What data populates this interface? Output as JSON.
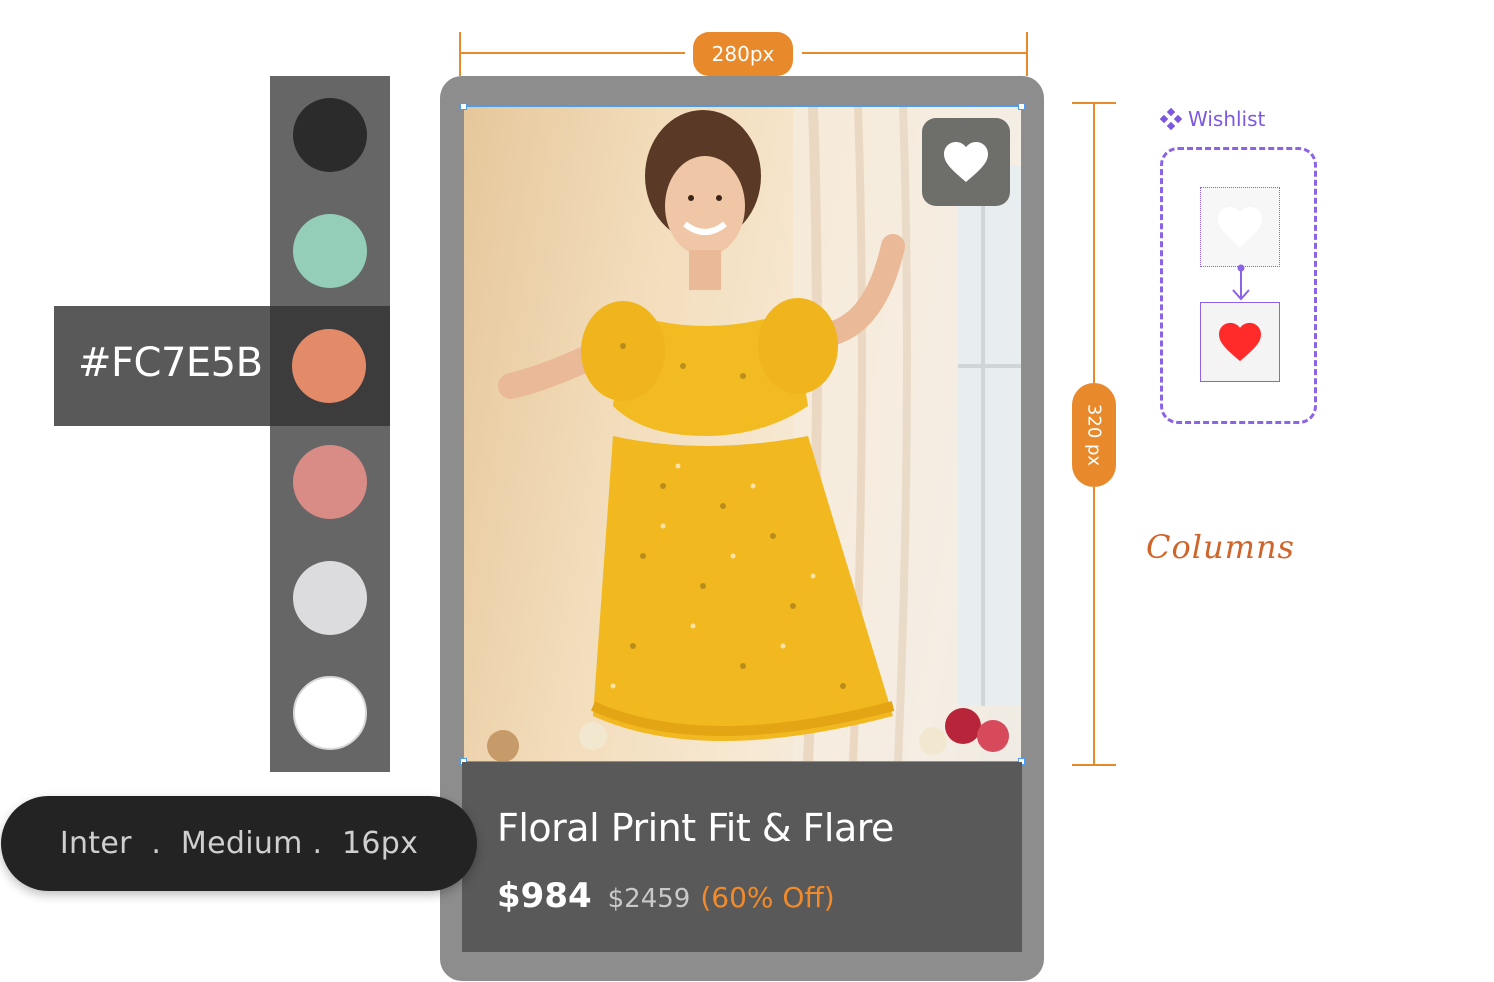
{
  "annotations": {
    "width_label": "280px",
    "height_label": "320 px",
    "accent_color": "#E8892C"
  },
  "product_card": {
    "image_alt": "Woman wearing yellow floral print fit and flare dress",
    "wishlist_icon": "heart-icon",
    "title": "Floral Print Fit & Flare",
    "price_current": "$984",
    "price_original": "$2459",
    "discount": "(60% Off)",
    "discount_color": "#F08A2B"
  },
  "palette": {
    "selected_hex": "#FC7E5B",
    "swatches": [
      "#2b2b2b",
      "#94cdb8",
      "#e38a69",
      "#d98b86",
      "#dcdbdd",
      "#ffffff"
    ]
  },
  "typography": {
    "spec": "Inter  .  Medium .  16px"
  },
  "wishlist_component": {
    "label": "Wishlist",
    "icon": "component-icon",
    "states": [
      "heart-outline-icon",
      "heart-filled-icon"
    ],
    "filled_color": "#ff2b2b"
  },
  "notes": {
    "handwritten": "Columns"
  }
}
